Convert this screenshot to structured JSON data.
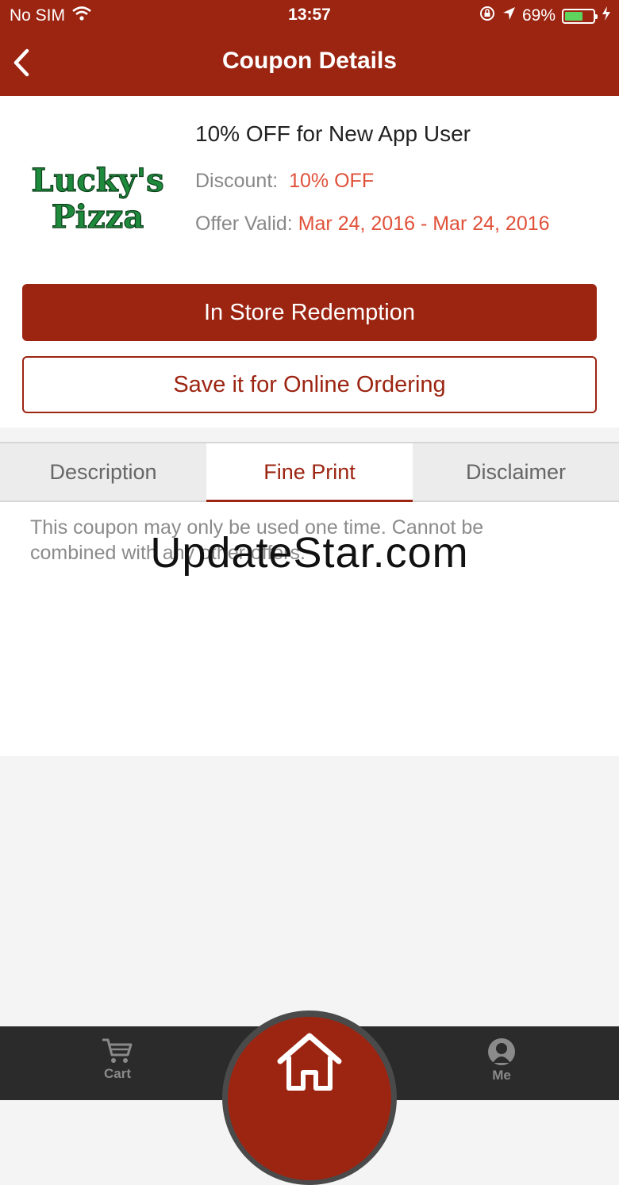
{
  "status_bar": {
    "carrier": "No SIM",
    "time": "13:57",
    "battery": "69%",
    "battery_level": 0.69
  },
  "nav": {
    "title": "Coupon Details"
  },
  "coupon": {
    "logo_text": [
      "Lucky's",
      "Pizza"
    ],
    "title": "10% OFF for New App User",
    "discount_label": "Discount:",
    "discount_value": "10% OFF",
    "valid_label": "Offer Valid:",
    "valid_value": "Mar 24, 2016 - Mar 24, 2016"
  },
  "buttons": {
    "redeem": "In Store Redemption",
    "save_online": "Save it for Online Ordering"
  },
  "tabs": [
    {
      "label": "Description",
      "active": false
    },
    {
      "label": "Fine Print",
      "active": true
    },
    {
      "label": "Disclaimer",
      "active": false
    }
  ],
  "fine_print": "This coupon may only be used one time. Cannot be combined with any other offers.",
  "watermark": "UpdateStar.com",
  "tab_bar": {
    "cart": "Cart",
    "me": "Me"
  },
  "colors": {
    "brand": "#9c2512",
    "accent": "#e0513a",
    "logo_green": "#1e8a3c"
  },
  "icons": [
    "wifi-icon",
    "orientation-lock-icon",
    "location-arrow-icon",
    "battery-icon",
    "charging-icon",
    "back-chevron-icon",
    "cart-icon",
    "home-icon",
    "person-icon"
  ]
}
